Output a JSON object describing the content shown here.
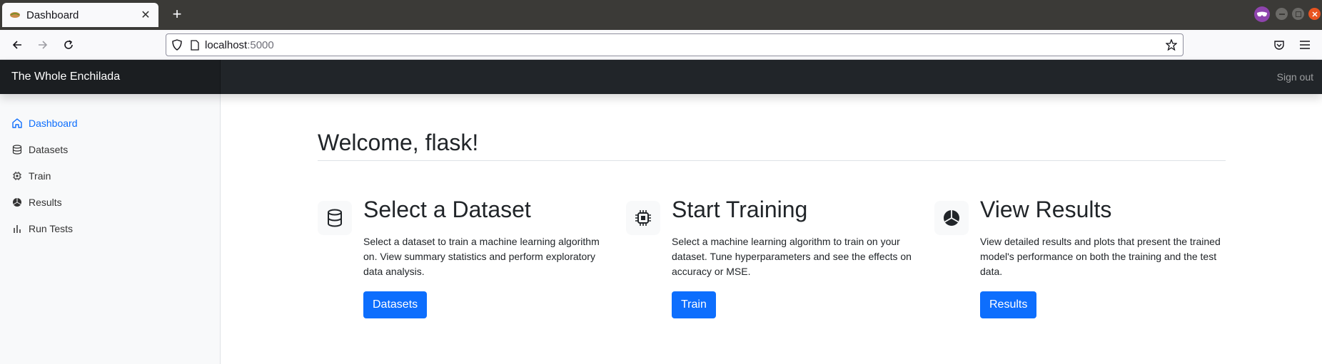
{
  "browser": {
    "tab_title": "Dashboard",
    "url_host": "localhost",
    "url_port": ":5000"
  },
  "header": {
    "brand": "The Whole Enchilada",
    "signout": "Sign out"
  },
  "sidebar": {
    "items": [
      {
        "label": "Dashboard",
        "icon": "home-icon",
        "active": true
      },
      {
        "label": "Datasets",
        "icon": "database-icon",
        "active": false
      },
      {
        "label": "Train",
        "icon": "cpu-icon",
        "active": false
      },
      {
        "label": "Results",
        "icon": "pie-chart-icon",
        "active": false
      },
      {
        "label": "Run Tests",
        "icon": "bar-chart-icon",
        "active": false
      }
    ]
  },
  "main": {
    "welcome": "Welcome, flask!",
    "features": [
      {
        "title": "Select a Dataset",
        "text": "Select a dataset to train a machine learning algorithm on. View summary statistics and perform exploratory data analysis.",
        "button": "Datasets",
        "icon": "database-icon"
      },
      {
        "title": "Start Training",
        "text": "Select a machine learning algorithm to train on your dataset. Tune hyperparameters and see the effects on accuracy or MSE.",
        "button": "Train",
        "icon": "cpu-icon"
      },
      {
        "title": "View Results",
        "text": "View detailed results and plots that present the trained model's performance on both the training and the test data.",
        "button": "Results",
        "icon": "pie-chart-icon"
      }
    ]
  },
  "colors": {
    "accent": "#0d6efd",
    "header_bg": "#212529",
    "sidebar_bg": "#f8f9fa"
  }
}
